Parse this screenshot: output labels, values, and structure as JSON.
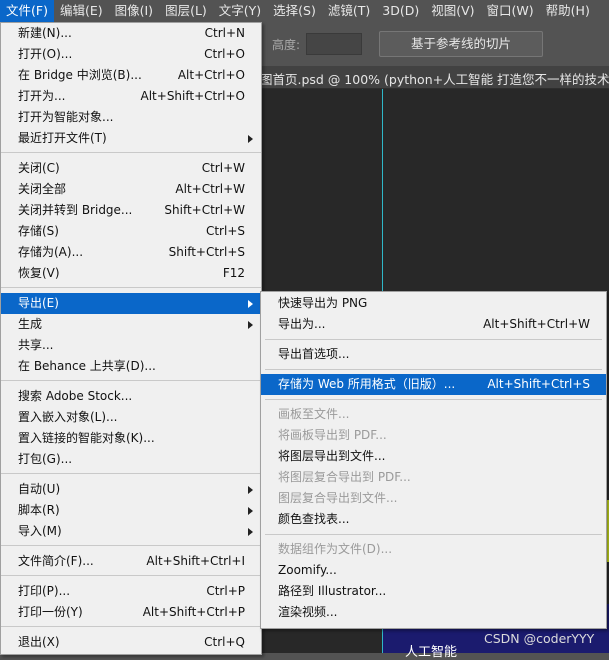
{
  "menubar": [
    "文件(F)",
    "编辑(E)",
    "图像(I)",
    "图层(L)",
    "文字(Y)",
    "选择(S)",
    "滤镜(T)",
    "3D(D)",
    "视图(V)",
    "窗口(W)",
    "帮助(H)"
  ],
  "optionsbar": {
    "height_label": "高度:",
    "slice_button": "基于参考线的切片"
  },
  "doc_tab": {
    "title": "图首页.psd @ 100% (python+人工智能   打造您不一样的技术职"
  },
  "canvas": {
    "text": "人工智能",
    "watermark": "CSDN @coderYYY",
    "guide_color": "#2fb7c7",
    "accent_color": "#1b1b6e"
  },
  "file_menu": {
    "items": [
      {
        "label": "新建(N)...",
        "shortcut": "Ctrl+N"
      },
      {
        "label": "打开(O)...",
        "shortcut": "Ctrl+O"
      },
      {
        "label": "在 Bridge 中浏览(B)...",
        "shortcut": "Alt+Ctrl+O"
      },
      {
        "label": "打开为...",
        "shortcut": "Alt+Shift+Ctrl+O"
      },
      {
        "label": "打开为智能对象...",
        "shortcut": ""
      },
      {
        "label": "最近打开文件(T)",
        "shortcut": "",
        "submenu": true
      },
      {
        "label": "关闭(C)",
        "shortcut": "Ctrl+W"
      },
      {
        "label": "关闭全部",
        "shortcut": "Alt+Ctrl+W"
      },
      {
        "label": "关闭并转到 Bridge...",
        "shortcut": "Shift+Ctrl+W"
      },
      {
        "label": "存储(S)",
        "shortcut": "Ctrl+S"
      },
      {
        "label": "存储为(A)...",
        "shortcut": "Shift+Ctrl+S"
      },
      {
        "label": "恢复(V)",
        "shortcut": "F12"
      },
      {
        "label": "导出(E)",
        "shortcut": "",
        "submenu": true,
        "highlight": true
      },
      {
        "label": "生成",
        "shortcut": "",
        "submenu": true
      },
      {
        "label": "共享...",
        "shortcut": ""
      },
      {
        "label": "在 Behance 上共享(D)...",
        "shortcut": ""
      },
      {
        "label": "搜索 Adobe Stock...",
        "shortcut": ""
      },
      {
        "label": "置入嵌入对象(L)...",
        "shortcut": ""
      },
      {
        "label": "置入链接的智能对象(K)...",
        "shortcut": ""
      },
      {
        "label": "打包(G)...",
        "shortcut": ""
      },
      {
        "label": "自动(U)",
        "shortcut": "",
        "submenu": true
      },
      {
        "label": "脚本(R)",
        "shortcut": "",
        "submenu": true
      },
      {
        "label": "导入(M)",
        "shortcut": "",
        "submenu": true
      },
      {
        "label": "文件简介(F)...",
        "shortcut": "Alt+Shift+Ctrl+I"
      },
      {
        "label": "打印(P)...",
        "shortcut": "Ctrl+P"
      },
      {
        "label": "打印一份(Y)",
        "shortcut": "Alt+Shift+Ctrl+P"
      },
      {
        "label": "退出(X)",
        "shortcut": "Ctrl+Q"
      }
    ]
  },
  "export_menu": {
    "items": [
      {
        "label": "快速导出为 PNG",
        "shortcut": ""
      },
      {
        "label": "导出为...",
        "shortcut": "Alt+Shift+Ctrl+W"
      },
      {
        "label": "导出首选项...",
        "shortcut": ""
      },
      {
        "label": "存储为 Web 所用格式（旧版）...",
        "shortcut": "Alt+Shift+Ctrl+S",
        "highlight": true
      },
      {
        "label": "画板至文件...",
        "shortcut": "",
        "disabled": true
      },
      {
        "label": "将画板导出到 PDF...",
        "shortcut": "",
        "disabled": true
      },
      {
        "label": "将图层导出到文件...",
        "shortcut": ""
      },
      {
        "label": "将图层复合导出到 PDF...",
        "shortcut": "",
        "disabled": true
      },
      {
        "label": "图层复合导出到文件...",
        "shortcut": "",
        "disabled": true
      },
      {
        "label": "颜色查找表...",
        "shortcut": ""
      },
      {
        "label": "数据组作为文件(D)...",
        "shortcut": "",
        "disabled": true
      },
      {
        "label": "Zoomify...",
        "shortcut": ""
      },
      {
        "label": "路径到 Illustrator...",
        "shortcut": ""
      },
      {
        "label": "渲染视频...",
        "shortcut": ""
      }
    ]
  }
}
